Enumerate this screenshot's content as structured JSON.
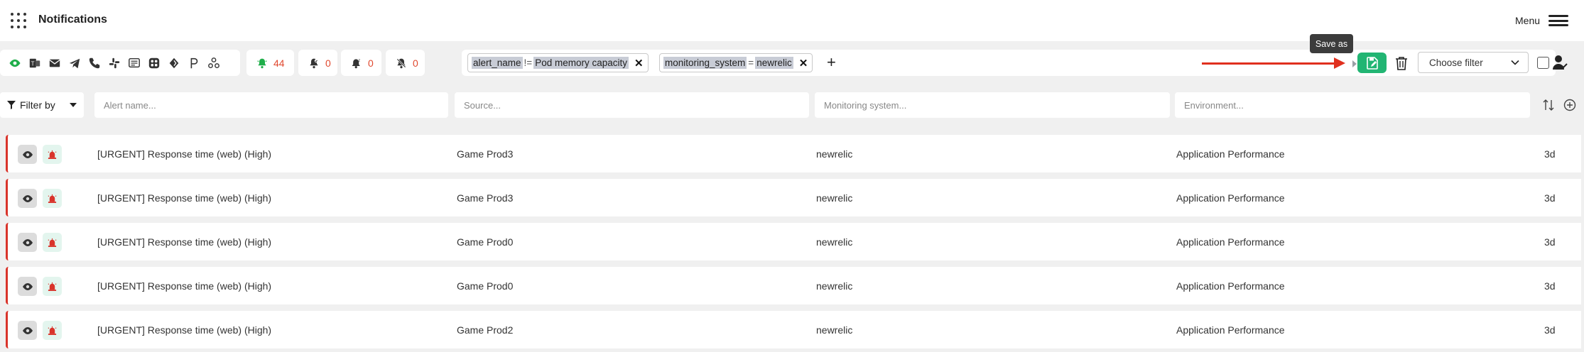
{
  "header": {
    "title": "Notifications",
    "menu_label": "Menu"
  },
  "channels": [
    "eye-icon",
    "teams-icon",
    "email-icon",
    "telegram-icon",
    "phone-icon",
    "slack-icon",
    "sms-icon",
    "matrix-icon",
    "webhook-icon",
    "pushover-icon",
    "integrations-icon"
  ],
  "counters": [
    {
      "icon": "bell-alert-icon",
      "value": "44",
      "color": "#1fae4a"
    },
    {
      "icon": "bell-ack-icon",
      "value": "0",
      "color": "#333333"
    },
    {
      "icon": "bell-snooze-icon",
      "value": "0",
      "color": "#333333"
    },
    {
      "icon": "bell-off-icon",
      "value": "0",
      "color": "#333333"
    }
  ],
  "filters": [
    {
      "field": "alert_name",
      "op": "!=",
      "value": "Pod memory capacity"
    },
    {
      "field": "monitoring_system",
      "op": "=",
      "value": "newrelic"
    }
  ],
  "add_filter_label": "+",
  "actions": {
    "save_tooltip": "Save as",
    "choose_filter": "Choose filter"
  },
  "search": {
    "filter_by_label": "Filter by",
    "alert_name_placeholder": "Alert name...",
    "source_placeholder": "Source...",
    "monitoring_placeholder": "Monitoring system...",
    "environment_placeholder": "Environment..."
  },
  "rows": [
    {
      "alert": "[URGENT] Response time (web) (High)",
      "source": "Game Prod3",
      "monitoring": "newrelic",
      "environment": "Application Performance",
      "age": "3d"
    },
    {
      "alert": "[URGENT] Response time (web) (High)",
      "source": "Game Prod3",
      "monitoring": "newrelic",
      "environment": "Application Performance",
      "age": "3d"
    },
    {
      "alert": "[URGENT] Response time (web) (High)",
      "source": "Game Prod0",
      "monitoring": "newrelic",
      "environment": "Application Performance",
      "age": "3d"
    },
    {
      "alert": "[URGENT] Response time (web) (High)",
      "source": "Game Prod0",
      "monitoring": "newrelic",
      "environment": "Application Performance",
      "age": "3d"
    },
    {
      "alert": "[URGENT] Response time (web) (High)",
      "source": "Game Prod2",
      "monitoring": "newrelic",
      "environment": "Application Performance",
      "age": "3d"
    }
  ],
  "colors": {
    "accent_green": "#22b573",
    "alert_red": "#d9342b",
    "arrow_red": "#e0301e"
  }
}
